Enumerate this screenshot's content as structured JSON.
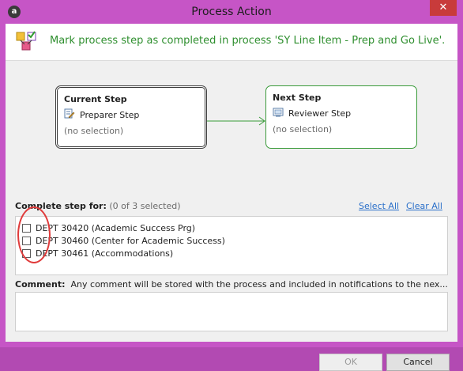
{
  "window": {
    "title": "Process Action",
    "close_symbol": "✕",
    "app_icon_letter": "a"
  },
  "header": {
    "message": "Mark process step as completed in process 'SY Line Item - Prep and Go Live'."
  },
  "current_step": {
    "title": "Current Step",
    "name": "Preparer Step",
    "selection": "(no selection)"
  },
  "next_step": {
    "title": "Next Step",
    "name": "Reviewer Step",
    "selection": "(no selection)"
  },
  "complete_step": {
    "label": "Complete step for:",
    "count": "(0 of 3 selected)",
    "select_all": "Select All",
    "clear_all": "Clear All",
    "items": [
      {
        "label": "DEPT 30420 (Academic Success Prg)",
        "checked": false
      },
      {
        "label": "DEPT 30460 (Center for Academic Success)",
        "checked": false
      },
      {
        "label": "DEPT 30461 (Accommodations)",
        "checked": false
      }
    ]
  },
  "comment": {
    "label": "Comment:",
    "hint": "Any comment will be stored with the process and included in notifications to the nex...",
    "value": ""
  },
  "buttons": {
    "ok": "OK",
    "cancel": "Cancel"
  },
  "colors": {
    "window_frame": "#c655c6",
    "close_button": "#c83b3b",
    "next_step_border": "#3a9b3a",
    "header_text": "#2f8f2f",
    "link": "#2a6fc9",
    "annotation": "#e03b3b"
  }
}
